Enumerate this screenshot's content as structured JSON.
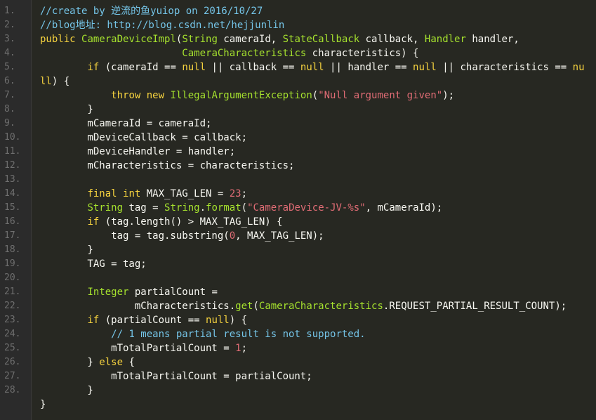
{
  "editor": {
    "line_numbers": [
      "1.",
      "2.",
      "3.",
      "4.",
      "5.",
      "6.",
      "7.",
      "8.",
      "9.",
      "10.",
      "11.",
      "12.",
      "13.",
      "14.",
      "15.",
      "16.",
      "17.",
      "18.",
      "19.",
      "20.",
      "21.",
      "22.",
      "23.",
      "24.",
      "25.",
      "26.",
      "27.",
      "28."
    ],
    "colors": {
      "background": "#272822",
      "gutter": "#2b2b2b",
      "comment": "#75c5e8",
      "keyword": "#f6d33f",
      "type": "#a6e22e",
      "string": "#e06c75",
      "plain": "#f8f8f2"
    },
    "lines": [
      [
        [
          "comment",
          "//create by 逆流的鱼yuiop on 2016/10/27"
        ]
      ],
      [
        [
          "comment",
          "//blog地址: http://blog.csdn.net/hejjunlin"
        ]
      ],
      [
        [
          "keyword",
          "public "
        ],
        [
          "fn",
          "CameraDeviceImpl"
        ],
        [
          "plain",
          "("
        ],
        [
          "type",
          "String"
        ],
        [
          "plain",
          " cameraId, "
        ],
        [
          "type",
          "StateCallback"
        ],
        [
          "plain",
          " callback, "
        ],
        [
          "type",
          "Handler"
        ],
        [
          "plain",
          " handler,"
        ]
      ],
      [
        [
          "plain",
          "                        "
        ],
        [
          "type",
          "CameraCharacteristics"
        ],
        [
          "plain",
          " characteristics) {"
        ]
      ],
      [
        [
          "plain",
          "        "
        ],
        [
          "keyword",
          "if"
        ],
        [
          "plain",
          " (cameraId == "
        ],
        [
          "keyword",
          "null"
        ],
        [
          "plain",
          " || callback == "
        ],
        [
          "keyword",
          "null"
        ],
        [
          "plain",
          " || handler == "
        ],
        [
          "keyword",
          "null"
        ],
        [
          "plain",
          " || characteristics == "
        ],
        [
          "keyword",
          "nu"
        ]
      ],
      [
        [
          "keyword",
          "ll"
        ],
        [
          "plain",
          ") {"
        ]
      ],
      [
        [
          "plain",
          "            "
        ],
        [
          "keyword",
          "throw new "
        ],
        [
          "type",
          "IllegalArgumentException"
        ],
        [
          "plain",
          "("
        ],
        [
          "string",
          "\"Null argument given\""
        ],
        [
          "plain",
          ");"
        ]
      ],
      [
        [
          "plain",
          "        }"
        ]
      ],
      [
        [
          "plain",
          "        mCameraId = cameraId;"
        ]
      ],
      [
        [
          "plain",
          "        mDeviceCallback = callback;"
        ]
      ],
      [
        [
          "plain",
          "        mDeviceHandler = handler;"
        ]
      ],
      [
        [
          "plain",
          "        mCharacteristics = characteristics;"
        ]
      ],
      [
        [
          "plain",
          ""
        ]
      ],
      [
        [
          "plain",
          "        "
        ],
        [
          "keyword",
          "final int"
        ],
        [
          "plain",
          " MAX_TAG_LEN = "
        ],
        [
          "number",
          "23"
        ],
        [
          "plain",
          ";"
        ]
      ],
      [
        [
          "plain",
          "        "
        ],
        [
          "type",
          "String"
        ],
        [
          "plain",
          " tag = "
        ],
        [
          "type",
          "String"
        ],
        [
          "plain",
          "."
        ],
        [
          "fn",
          "format"
        ],
        [
          "plain",
          "("
        ],
        [
          "string",
          "\"CameraDevice-JV-%s\""
        ],
        [
          "plain",
          ", mCameraId);"
        ]
      ],
      [
        [
          "plain",
          "        "
        ],
        [
          "keyword",
          "if"
        ],
        [
          "plain",
          " (tag.length() > MAX_TAG_LEN) {"
        ]
      ],
      [
        [
          "plain",
          "            tag = tag.substring("
        ],
        [
          "number",
          "0"
        ],
        [
          "plain",
          ", MAX_TAG_LEN);"
        ]
      ],
      [
        [
          "plain",
          "        }"
        ]
      ],
      [
        [
          "plain",
          "        TAG = tag;"
        ]
      ],
      [
        [
          "plain",
          ""
        ]
      ],
      [
        [
          "plain",
          "        "
        ],
        [
          "type",
          "Integer"
        ],
        [
          "plain",
          " partialCount ="
        ]
      ],
      [
        [
          "plain",
          "                mCharacteristics."
        ],
        [
          "fn",
          "get"
        ],
        [
          "plain",
          "("
        ],
        [
          "type",
          "CameraCharacteristics"
        ],
        [
          "plain",
          ".REQUEST_PARTIAL_RESULT_COUNT);"
        ]
      ],
      [
        [
          "plain",
          "        "
        ],
        [
          "keyword",
          "if"
        ],
        [
          "plain",
          " (partialCount == "
        ],
        [
          "keyword",
          "null"
        ],
        [
          "plain",
          ") {"
        ]
      ],
      [
        [
          "plain",
          "            "
        ],
        [
          "comment",
          "// 1 means partial result is not supported."
        ]
      ],
      [
        [
          "plain",
          "            mTotalPartialCount = "
        ],
        [
          "number",
          "1"
        ],
        [
          "plain",
          ";"
        ]
      ],
      [
        [
          "plain",
          "        } "
        ],
        [
          "keyword",
          "else"
        ],
        [
          "plain",
          " {"
        ]
      ],
      [
        [
          "plain",
          "            mTotalPartialCount = partialCount;"
        ]
      ],
      [
        [
          "plain",
          "        }"
        ]
      ],
      [
        [
          "plain",
          "}"
        ]
      ]
    ]
  }
}
